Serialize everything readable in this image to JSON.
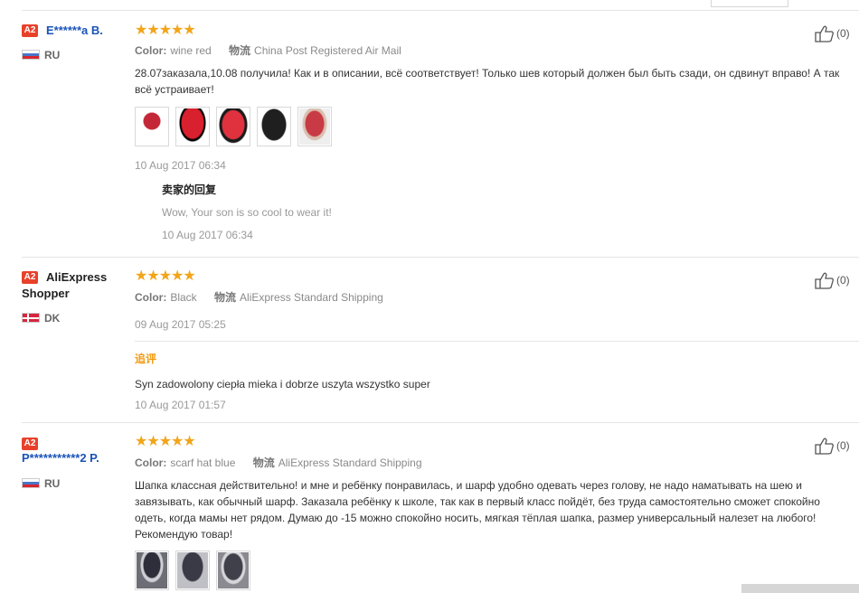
{
  "labels": {
    "color_key": "Color:",
    "shipping_key": "物流",
    "seller_reply_title": "卖家的回复",
    "additional_title": "追评"
  },
  "reviews": [
    {
      "badge": "A2",
      "username": "E******a B.",
      "country": "RU",
      "stars": "★★★★★",
      "color": "wine red",
      "shipping": "China Post Registered Air Mail",
      "text": "28.07заказала,10.08 получила! Как и в описании, всё соответствует! Только шев который должен был быть сзади, он сдвинут вправо! А так всё устраивает!",
      "date": "10 Aug 2017 06:34",
      "likes": "(0)",
      "images": [
        "red-hat-child-photo",
        "red-hat-photo",
        "red-hat-photo",
        "black-hat-photo",
        "red-hat-photo"
      ],
      "seller_reply": {
        "text": "Wow, Your son is so cool to wear it!",
        "date": "10 Aug 2017 06:34"
      }
    },
    {
      "badge": "A2",
      "username": "AliExpress Shopper",
      "country": "DK",
      "stars": "★★★★★",
      "color": "Black",
      "shipping": "AliExpress Standard Shipping",
      "date": "09 Aug 2017 05:25",
      "likes": "(0)",
      "additional": {
        "text": "Syn zadowolony ciepła mieka i dobrze uszyta wszystko super",
        "date": "10 Aug 2017 01:57"
      }
    },
    {
      "badge": "A2",
      "username": "P***********2 P.",
      "country": "RU",
      "stars": "★★★★★",
      "color": "scarf hat blue",
      "shipping": "AliExpress Standard Shipping",
      "text": "Шапка классная действительно! и мне и ребёнку понравилась, и шарф удобно одевать через голову, не надо наматывать на шею и завязывать, как обычный шарф. Заказала ребёнку к школе, так как в первый класс пойдёт, без труда самостоятельно сможет спокойно одеть, когда мамы нет рядом. Думаю до -15 можно спокойно носить, мягкая тёплая шапка, размер универсальный налезет на любого! Рекомендую товар!",
      "likes": "(0)",
      "images": [
        "grey-scarf-hat-photo",
        "grey-scarf-hat-photo",
        "grey-scarf-hat-photo"
      ]
    }
  ]
}
